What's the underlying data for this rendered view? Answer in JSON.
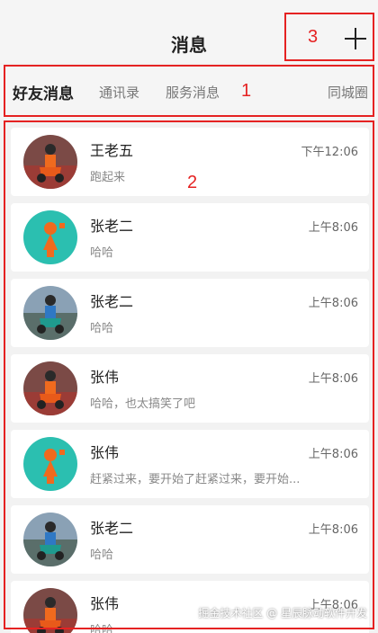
{
  "header": {
    "title": "消息"
  },
  "tabs": [
    {
      "label": "好友消息"
    },
    {
      "label": "通讯录"
    },
    {
      "label": "服务消息"
    },
    {
      "label": "同城圈"
    }
  ],
  "annotations": {
    "one": "1",
    "two": "2",
    "three": "3"
  },
  "messages": [
    {
      "name": "王老五",
      "time": "下午12:06",
      "preview": "跑起来",
      "avatar": "scooter-red-avatar"
    },
    {
      "name": "张老二",
      "time": "上午8:06",
      "preview": "哈哈",
      "avatar": "cartoon-orange-avatar"
    },
    {
      "name": "张老二",
      "time": "上午8:06",
      "preview": "哈哈",
      "avatar": "scooter-blue-avatar"
    },
    {
      "name": "张伟",
      "time": "上午8:06",
      "preview": "哈哈，也太搞笑了吧",
      "avatar": "scooter-red-avatar"
    },
    {
      "name": "张伟",
      "time": "上午8:06",
      "preview": "赶紧过来，要开始了赶紧过来，要开始...",
      "avatar": "cartoon-orange-avatar"
    },
    {
      "name": "张老二",
      "time": "上午8:06",
      "preview": "哈哈",
      "avatar": "scooter-blue-avatar"
    },
    {
      "name": "张伟",
      "time": "上午8:06",
      "preview": "哈哈",
      "avatar": "scooter-red-avatar"
    }
  ],
  "watermark": "掘金技术社区 @ 星辰脉动软件开发",
  "colors": {
    "accent": "#e52222",
    "avatar_teal": "#2bbfb0",
    "avatar_orange": "#f06a1e"
  }
}
